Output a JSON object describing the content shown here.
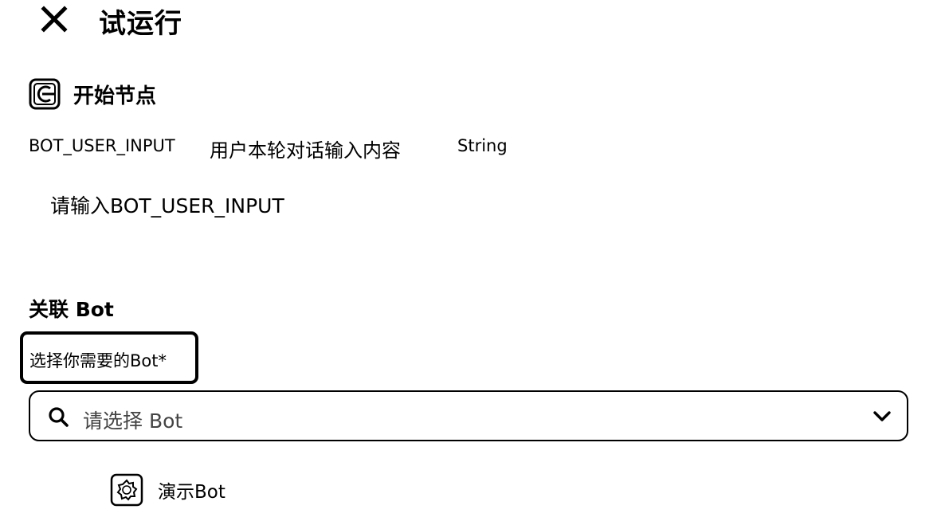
{
  "header": {
    "title": "试运行",
    "close_icon": "close-icon"
  },
  "start_node": {
    "title": "开始节点",
    "icon": "start-node-icon",
    "variable": {
      "name": "BOT_USER_INPUT",
      "description": "用户本轮对话输入内容",
      "type": "String"
    },
    "input": {
      "placeholder": "请输入BOT_USER_INPUT",
      "value": ""
    }
  },
  "bot_section": {
    "title": "关联 Bot",
    "field_label": "选择你需要的Bot*",
    "select": {
      "placeholder": "请选择 Bot",
      "search_icon": "search-icon",
      "chevron_icon": "chevron-down-icon"
    },
    "options": [
      {
        "label": "演示Bot",
        "icon": "bot-avatar-icon"
      }
    ]
  }
}
